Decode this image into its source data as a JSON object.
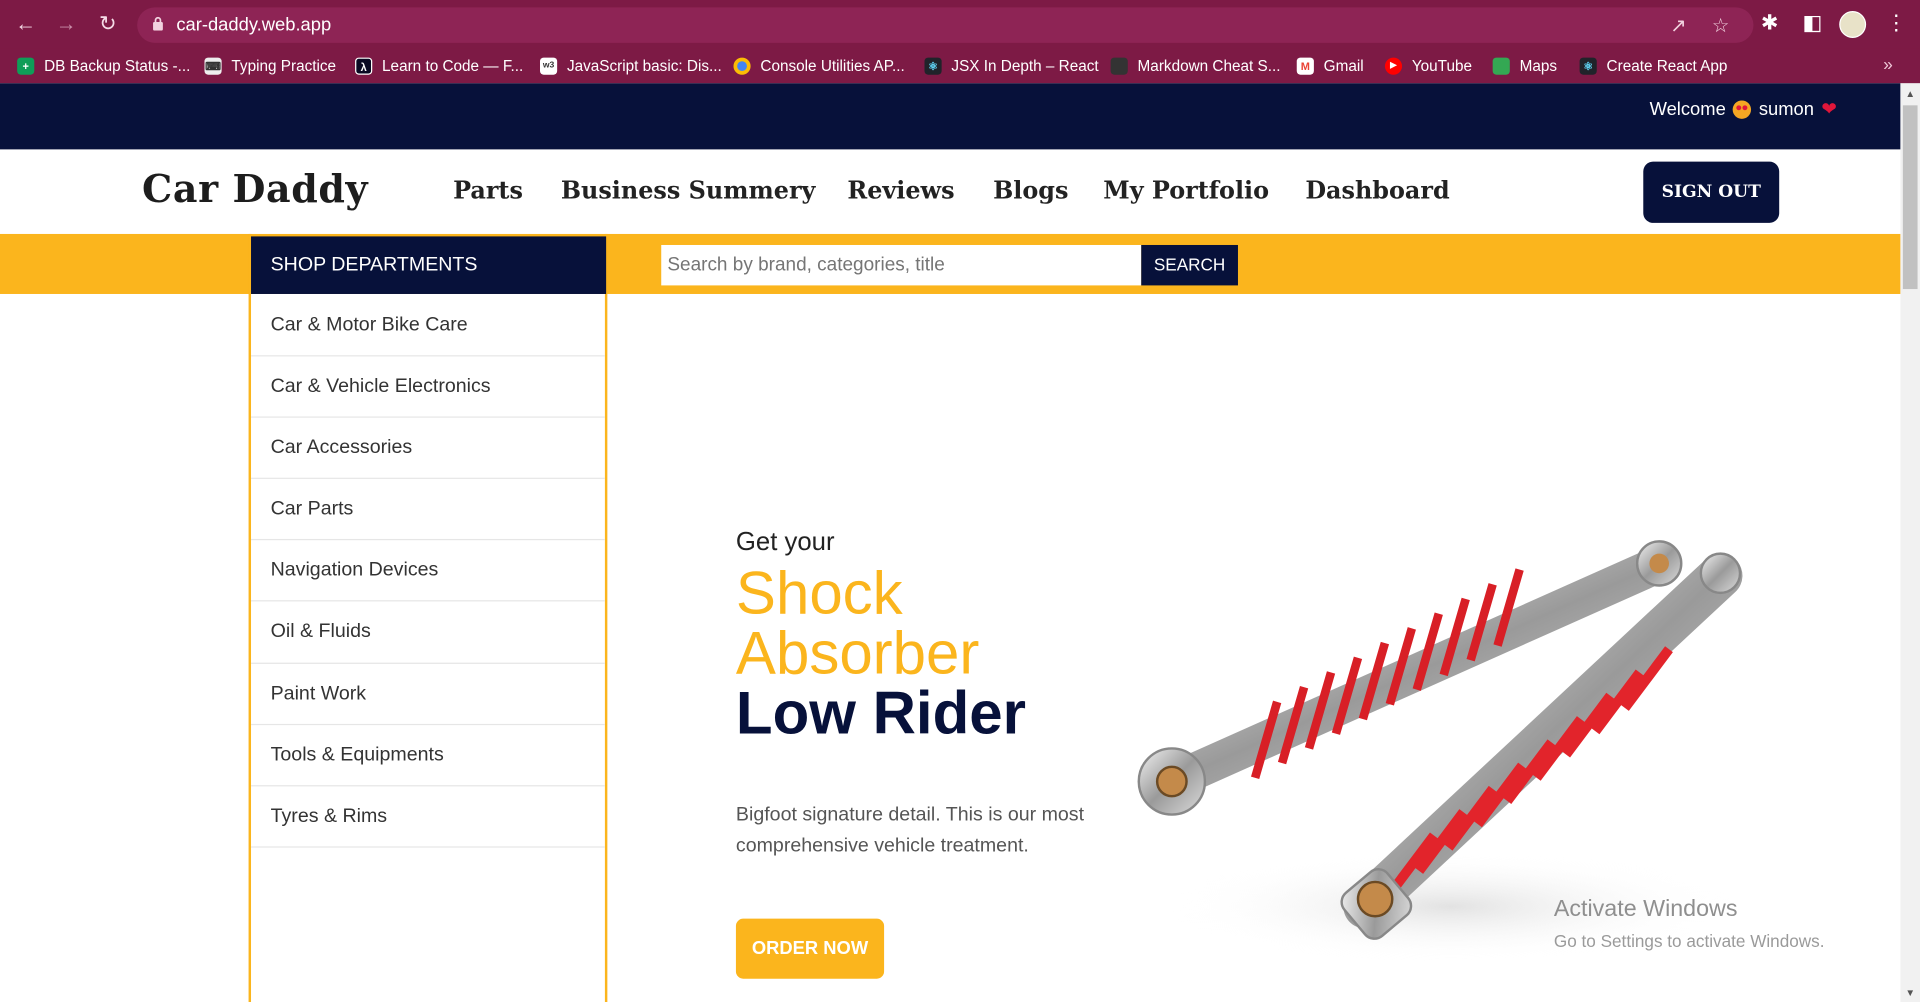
{
  "browser": {
    "url": "car-daddy.web.app",
    "bookmarks": [
      {
        "label": "DB Backup Status -...",
        "icon": "sheets-icon",
        "color": "#0f9d58"
      },
      {
        "label": "Typing Practice",
        "icon": "keyboard-icon",
        "color": "#ffffff"
      },
      {
        "label": "Learn to Code — F...",
        "icon": "freecodecamp-icon",
        "color": "#0a0a23"
      },
      {
        "label": "JavaScript basic: Dis...",
        "icon": "w3-icon",
        "color": "#ffffff"
      },
      {
        "label": "Console Utilities AP...",
        "icon": "chrome-icon",
        "color": "#4285f4"
      },
      {
        "label": "JSX In Depth – React",
        "icon": "react-icon",
        "color": "#20232a"
      },
      {
        "label": "Markdown Cheat S...",
        "icon": "markdown-icon",
        "color": "#333333"
      },
      {
        "label": "Gmail",
        "icon": "gmail-icon",
        "color": "#ea4335"
      },
      {
        "label": "YouTube",
        "icon": "youtube-icon",
        "color": "#ff0000"
      },
      {
        "label": "Maps",
        "icon": "maps-icon",
        "color": "#34a853"
      },
      {
        "label": "Create React App",
        "icon": "react-icon",
        "color": "#20232a"
      }
    ]
  },
  "topbar": {
    "welcome": "Welcome",
    "user": "sumon"
  },
  "header": {
    "brand": "Car Daddy",
    "menu": [
      "Parts",
      "Business Summery",
      "Reviews",
      "Blogs",
      "My Portfolio",
      "Dashboard"
    ],
    "signout": "SIGN OUT"
  },
  "departments": {
    "title": "SHOP DEPARTMENTS",
    "items": [
      "Car & Motor Bike Care",
      "Car & Vehicle Electronics",
      "Car Accessories",
      "Car Parts",
      "Navigation Devices",
      "Oil & Fluids",
      "Paint Work",
      "Tools & Equipments",
      "Tyres & Rims"
    ]
  },
  "search": {
    "placeholder": "Search by brand, categories, title",
    "button": "SEARCH"
  },
  "hero": {
    "kicker": "Get your",
    "line1": "Shock",
    "line2": "Absorber",
    "line3": "Low Rider",
    "description": "Bigfoot signature detail. This is our most comprehensive vehicle treatment.",
    "cta": "ORDER NOW"
  },
  "watermark": {
    "title": "Activate Windows",
    "subtitle": "Go to Settings to activate Windows."
  },
  "colors": {
    "navy": "#07113a",
    "yellow": "#fbb51d",
    "chrome": "#7d1a45"
  }
}
